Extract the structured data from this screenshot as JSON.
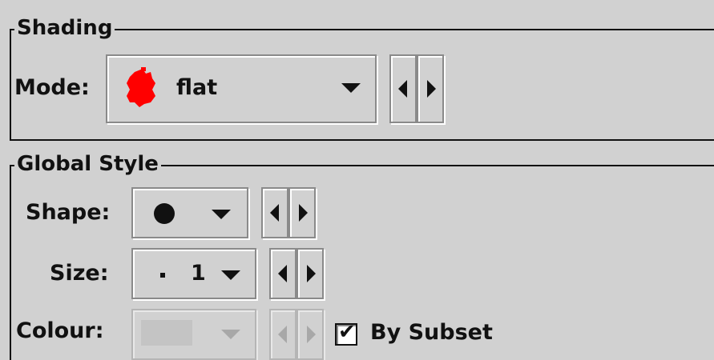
{
  "shading": {
    "title": "Shading",
    "mode_label": "Mode:",
    "mode_value": "flat",
    "mode_icon": "red-blob-icon",
    "mode_icon_color": "#ff0000"
  },
  "global_style": {
    "title": "Global Style",
    "shape_label": "Shape:",
    "shape_value": "●",
    "shape_icon": "filled-circle-icon",
    "size_label": "Size:",
    "size_value": "1",
    "size_icon": "small-square-icon",
    "colour_label": "Colour:",
    "colour_enabled": false,
    "by_subset_label": "By Subset",
    "by_subset_checked": true
  },
  "colors": {
    "panel_bg": "#d1d1d1",
    "text": "#111111",
    "disabled": "#a8a8a8",
    "mode_icon": "#ff0000"
  }
}
